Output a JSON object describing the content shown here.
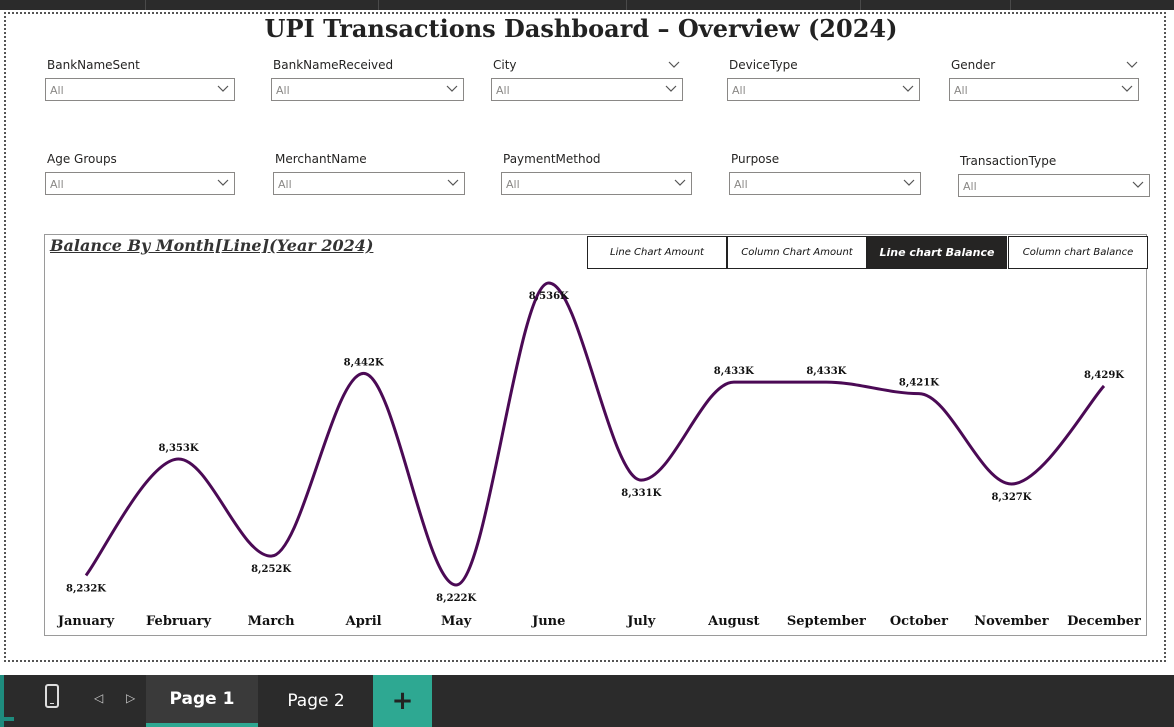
{
  "dashboard_title": "UPI Transactions Dashboard – Overview (2024)",
  "slicers": [
    {
      "label": "BankNameSent",
      "value": "All"
    },
    {
      "label": "BankNameReceived",
      "value": "All"
    },
    {
      "label": "City",
      "value": "All"
    },
    {
      "label": "DeviceType",
      "value": "All"
    },
    {
      "label": "Gender",
      "value": "All"
    },
    {
      "label": "Age Groups",
      "value": "All"
    },
    {
      "label": "MerchantName",
      "value": "All"
    },
    {
      "label": "PaymentMethod",
      "value": "All"
    },
    {
      "label": "Purpose",
      "value": "All"
    },
    {
      "label": "TransactionType",
      "value": "All"
    }
  ],
  "chart_title": "Balance By Month[Line](Year 2024)",
  "toggle_buttons": [
    {
      "label": "Line Chart Amount",
      "active": false
    },
    {
      "label": "Column Chart Amount",
      "active": false
    },
    {
      "label": "Line chart Balance",
      "active": true
    },
    {
      "label": "Column chart Balance",
      "active": false
    }
  ],
  "chart_data": {
    "type": "line",
    "title": "Balance By Month[Line](Year 2024)",
    "categories": [
      "January",
      "February",
      "March",
      "April",
      "May",
      "June",
      "July",
      "August",
      "September",
      "October",
      "November",
      "December"
    ],
    "series": [
      {
        "values": [
          8232,
          8353,
          8252,
          8442,
          8222,
          8536,
          8331,
          8433,
          8433,
          8421,
          8327,
          8429
        ],
        "labels": [
          "8,232K",
          "8,353K",
          "8,252K",
          "8,442K",
          "8,222K",
          "8,536K",
          "8,331K",
          "8,433K",
          "8,433K",
          "8,421K",
          "8,327K",
          "8,429K"
        ],
        "color": "#4b0a55"
      }
    ],
    "unit": "K",
    "grid": false,
    "legend": "none"
  },
  "pages": [
    {
      "label": "Page 1",
      "active": true
    },
    {
      "label": "Page 2",
      "active": false
    }
  ],
  "add_page_label": "+",
  "colors": {
    "line": "#4b0a55",
    "accent": "#2ea892",
    "chrome": "#2b2b2b"
  }
}
